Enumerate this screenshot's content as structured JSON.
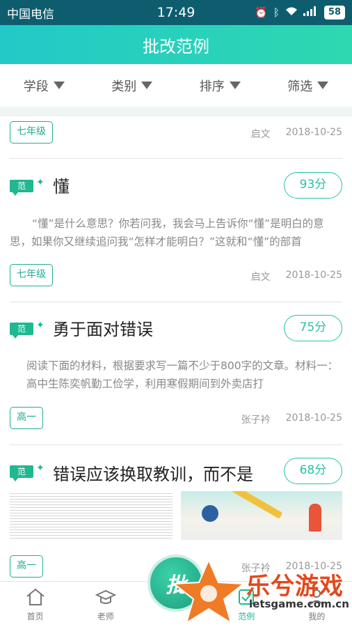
{
  "status": {
    "carrier": "中国电信",
    "time": "17:49",
    "battery": "58"
  },
  "header": {
    "title": "批改范例"
  },
  "filters": [
    "学段",
    "类别",
    "排序",
    "筛选"
  ],
  "cards": [
    {
      "grade": "七年级",
      "author": "启文",
      "date": "2018-10-25"
    },
    {
      "badge": "范",
      "title": "懂",
      "score": "93分",
      "excerpt": "“懂”是什么意思？你若问我，我会马上告诉你“懂”是明白的意思，如果你又继续追问我“怎样才能明白？”这就和“懂”的部首",
      "grade": "七年级",
      "author": "启文",
      "date": "2018-10-25"
    },
    {
      "badge": "范",
      "title": "勇于面对错误",
      "score": "75分",
      "excerpt": "阅读下面的材料，根据要求写一篇不少于800字的文章。材料一：高中生陈奕帆勤工俭学，利用寒假期间到外卖店打",
      "grade": "高一",
      "author": "张子衿",
      "date": "2018-10-25"
    },
    {
      "badge": "范",
      "title": "错误应该换取教训，而不是",
      "score": "68分",
      "grade": "高一",
      "author": "张子衿",
      "date": "2018-10-25"
    }
  ],
  "tabs": [
    {
      "label": "首页",
      "icon": "home-icon"
    },
    {
      "label": "老师",
      "icon": "teacher-hat-icon"
    },
    {
      "label": "",
      "icon": "camera-fab"
    },
    {
      "label": "范例",
      "icon": "example-icon"
    },
    {
      "label": "我的",
      "icon": "profile-icon"
    }
  ],
  "fab": {
    "label": "批"
  },
  "watermark": {
    "brand": "乐兮游戏",
    "url": "letsgame.com.cn"
  },
  "colors": {
    "accent": "#1fb890",
    "header_start": "#22c9c8",
    "header_end": "#2ed8b0",
    "statusbar": "#0e5d6e",
    "watermark": "#e5481b"
  }
}
